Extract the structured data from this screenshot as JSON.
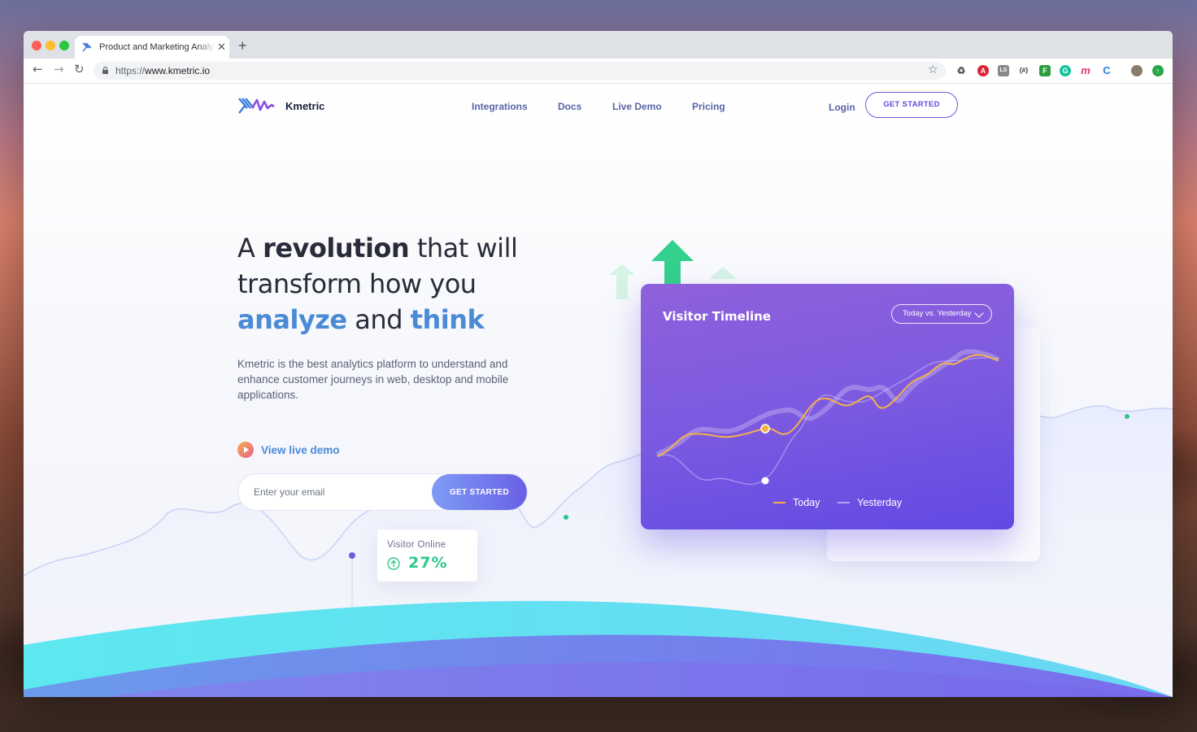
{
  "browser": {
    "tab_title": "Product and Marketing Analytics",
    "url_scheme": "https://",
    "url_host": "www.kmetric.io",
    "extensions": [
      "recycle-icon",
      "adblock-icon",
      "ls-icon",
      "json-icon",
      "green-square-icon",
      "grammarly-icon",
      "m-icon",
      "refresh-c-icon",
      "profile-avatar",
      "upload-icon"
    ]
  },
  "nav": {
    "brand": "Kmetric",
    "links": [
      "Integrations",
      "Docs",
      "Live Demo",
      "Pricing"
    ],
    "login": "Login",
    "cta": "GET STARTED"
  },
  "hero": {
    "line1_a": "A ",
    "line1_b": "revolution",
    "line1_c": " that will",
    "line2": "transform how you",
    "line3_a": "analyze",
    "line3_b": " and ",
    "line3_c": "think",
    "description": "Kmetric is the best analytics platform to understand and enhance customer journeys in web, desktop and mobile applications.",
    "demo_link": "View live demo",
    "email_placeholder": "Enter your email",
    "email_button": "GET STARTED"
  },
  "visitor_online": {
    "label": "Visitor Online",
    "value": "27%"
  },
  "timeline": {
    "title": "Visitor Timeline",
    "select_value": "Today vs. Yesterday",
    "legend_today": "Today",
    "legend_yesterday": "Yesterday"
  },
  "colors": {
    "accent_purple": "#6a5fe0",
    "accent_blue": "#4a8ad6",
    "accent_green": "#2cc98a",
    "today_line": "#f3b04b"
  }
}
